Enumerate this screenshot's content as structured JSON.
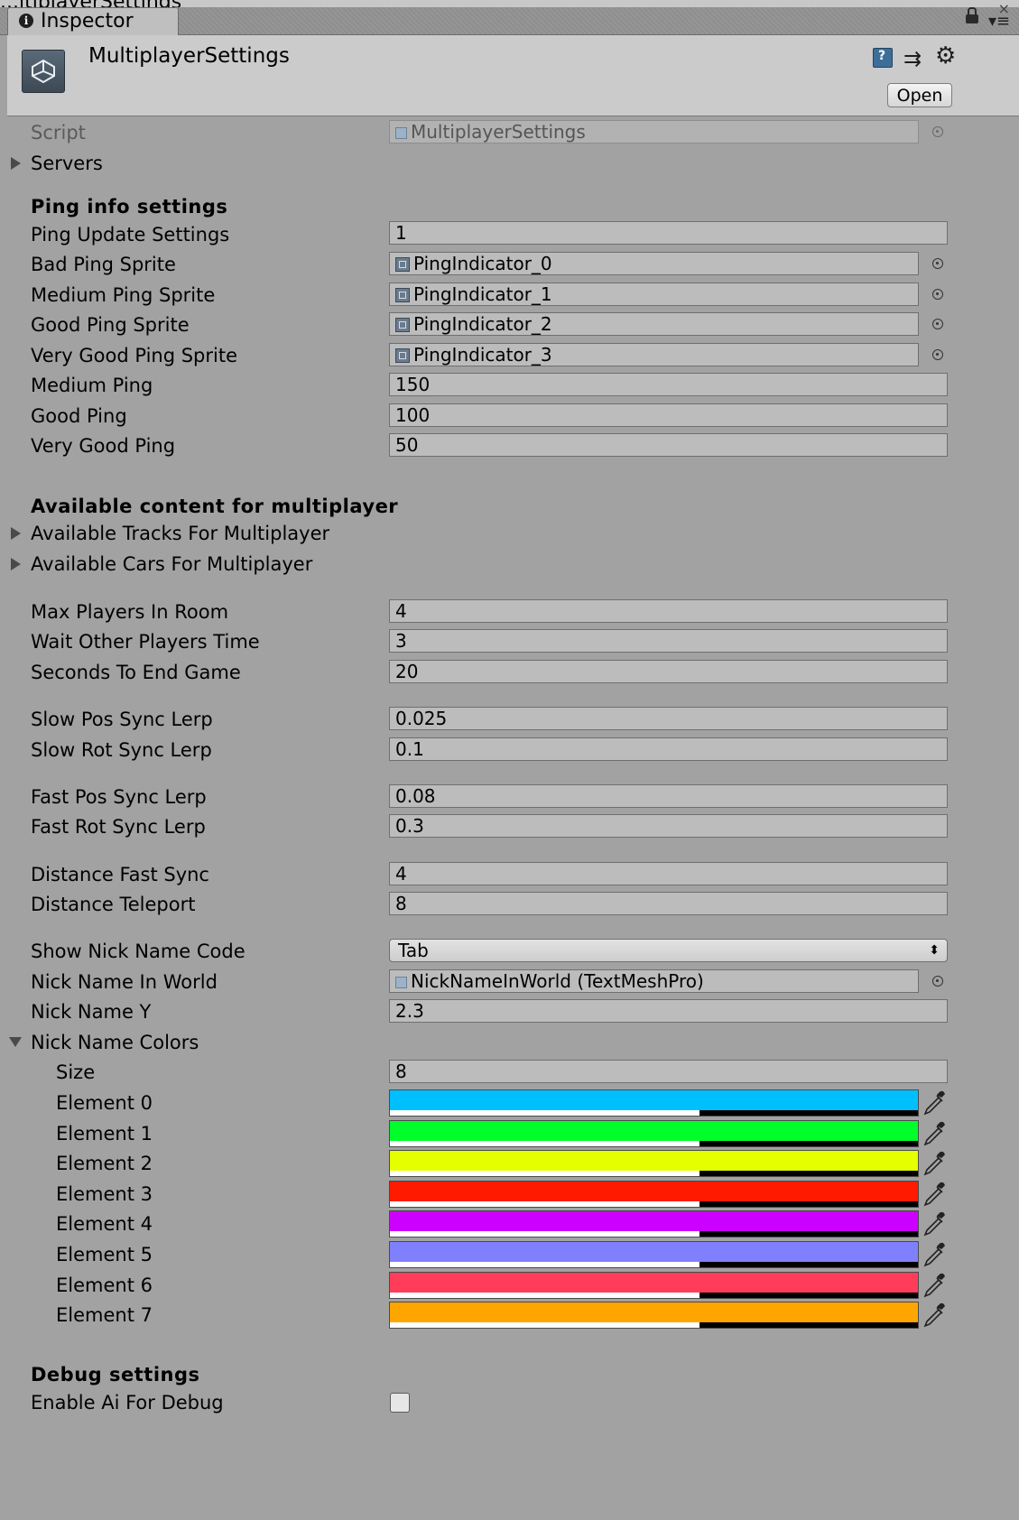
{
  "window": {
    "top_partial_text": "...ltiplayerSettings",
    "tab_label": "Inspector"
  },
  "header": {
    "title": "MultiplayerSettings",
    "open_label": "Open"
  },
  "script_row": {
    "label": "Script",
    "value": "MultiplayerSettings"
  },
  "servers": {
    "label": "Servers"
  },
  "ping": {
    "heading": "Ping info settings",
    "update_label": "Ping Update Settings",
    "update_value": "1",
    "bad_label": "Bad Ping Sprite",
    "bad_value": "PingIndicator_0",
    "medium_sprite_label": "Medium Ping Sprite",
    "medium_sprite_value": "PingIndicator_1",
    "good_sprite_label": "Good Ping Sprite",
    "good_sprite_value": "PingIndicator_2",
    "very_good_sprite_label": "Very Good Ping Sprite",
    "very_good_sprite_value": "PingIndicator_3",
    "medium_label": "Medium Ping",
    "medium_value": "150",
    "good_label": "Good Ping",
    "good_value": "100",
    "very_good_label": "Very Good Ping",
    "very_good_value": "50"
  },
  "content": {
    "heading": "Available content for multiplayer",
    "tracks_label": "Available Tracks For Multiplayer",
    "cars_label": "Available Cars For Multiplayer"
  },
  "room": {
    "max_players_label": "Max Players In Room",
    "max_players_value": "4",
    "wait_label": "Wait Other Players Time",
    "wait_value": "3",
    "end_label": "Seconds To End Game",
    "end_value": "20"
  },
  "sync": {
    "slow_pos_label": "Slow Pos Sync Lerp",
    "slow_pos_value": "0.025",
    "slow_rot_label": "Slow Rot Sync Lerp",
    "slow_rot_value": "0.1",
    "fast_pos_label": "Fast Pos Sync Lerp",
    "fast_pos_value": "0.08",
    "fast_rot_label": "Fast Rot Sync Lerp",
    "fast_rot_value": "0.3",
    "dist_fast_label": "Distance Fast Sync",
    "dist_fast_value": "4",
    "dist_tp_label": "Distance Teleport",
    "dist_tp_value": "8"
  },
  "nick": {
    "code_label": "Show Nick Name Code",
    "code_value": "Tab",
    "world_label": "Nick Name In World",
    "world_value": "NickNameInWorld (TextMeshPro)",
    "y_label": "Nick Name Y",
    "y_value": "2.3",
    "colors_label": "Nick Name Colors",
    "size_label": "Size",
    "size_value": "8",
    "elements": [
      {
        "label": "Element 0",
        "color": "#00bfff"
      },
      {
        "label": "Element 1",
        "color": "#00ff2a"
      },
      {
        "label": "Element 2",
        "color": "#e6ff00"
      },
      {
        "label": "Element 3",
        "color": "#ff1a00"
      },
      {
        "label": "Element 4",
        "color": "#cc00ff"
      },
      {
        "label": "Element 5",
        "color": "#8080ff"
      },
      {
        "label": "Element 6",
        "color": "#ff3d5a"
      },
      {
        "label": "Element 7",
        "color": "#ffa500"
      }
    ]
  },
  "debug": {
    "heading": "Debug settings",
    "enable_ai_label": "Enable Ai For Debug",
    "enable_ai_checked": false
  }
}
